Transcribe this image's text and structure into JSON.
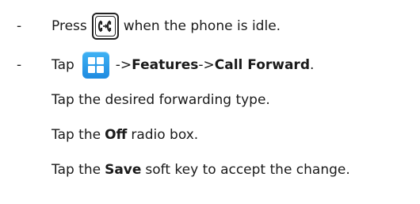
{
  "bullet": "-",
  "lines": {
    "press": {
      "before": "Press",
      "after": "when the phone is idle.",
      "icon": "call-forward-key-icon"
    },
    "tap_menu": {
      "before": "Tap",
      "arrow1": "->",
      "features": "Features",
      "arrow2": "->",
      "call_forward": "Call Forward",
      "end": ".",
      "icon": "menu-key-icon",
      "icon_color": "#2a9cec"
    },
    "tap_type": "Tap the desired forwarding type.",
    "tap_off": {
      "before": "Tap the",
      "bold": "Off",
      "after": "radio box."
    },
    "tap_save": {
      "before": "Tap the",
      "bold": "Save",
      "after": "soft key to accept the change."
    }
  }
}
